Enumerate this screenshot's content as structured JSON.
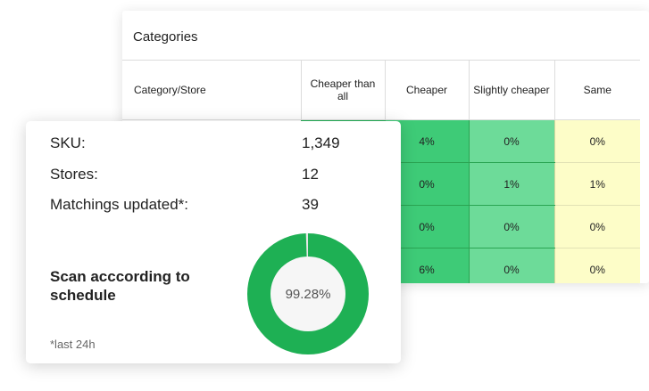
{
  "categories_panel": {
    "title": "Categories",
    "headers": [
      "Category/Store",
      "Cheaper than all",
      "Cheaper",
      "Slightly cheaper",
      "Same"
    ],
    "rows": [
      [
        "",
        "",
        "4%",
        "0%",
        "0%"
      ],
      [
        "",
        "",
        "0%",
        "1%",
        "1%"
      ],
      [
        "",
        "",
        "0%",
        "0%",
        "0%"
      ],
      [
        "",
        "",
        "6%",
        "0%",
        "0%"
      ]
    ]
  },
  "summary": {
    "stats": [
      {
        "label": "SKU:",
        "value": "1,349"
      },
      {
        "label": "Stores:",
        "value": "12"
      },
      {
        "label": "Matchings updated*:",
        "value": "39"
      }
    ],
    "scan_title": "Scan acccording to schedule",
    "footnote": "*last 24h",
    "progress_percent": 99.28,
    "progress_label": "99.28%"
  },
  "colors": {
    "cheaper_than_all": "#1eb054",
    "cheaper": "#3ecb77",
    "slightly_cheaper": "#6ddb99",
    "same": "#fdfdc8",
    "donut_fill": "#1eb054",
    "donut_center": "#f6f6f6"
  }
}
